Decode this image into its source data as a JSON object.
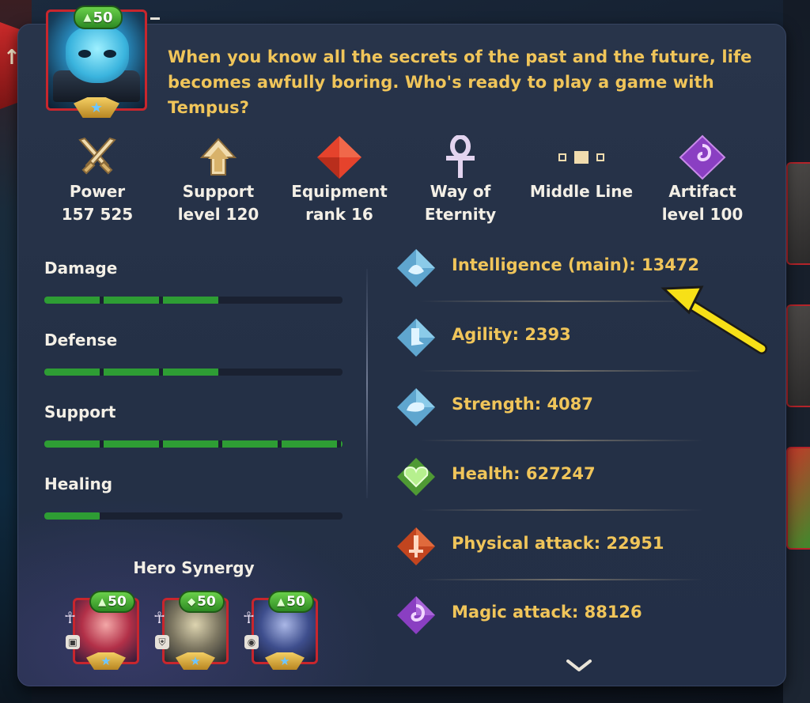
{
  "hero": {
    "level": "50",
    "quote": "When you know all the secrets of the past and the future, life becomes awfully boring. Who's ready to play a game with Tempus?"
  },
  "stats": [
    {
      "icon": "crossed-swords-icon",
      "line1": "Power",
      "line2": "157 525"
    },
    {
      "icon": "support-arrow-icon",
      "line1": "Support",
      "line2": "level 120"
    },
    {
      "icon": "red-diamond-icon",
      "line1": "Equipment",
      "line2": "rank 16"
    },
    {
      "icon": "ankh-icon",
      "line1": "Way of",
      "line2": "Eternity"
    },
    {
      "icon": "middle-line-icon",
      "line1": "Middle Line",
      "line2": ""
    },
    {
      "icon": "artifact-icon",
      "line1": "Artifact",
      "line2": "level 100"
    }
  ],
  "roles": [
    {
      "label": "Damage",
      "segments": 3,
      "max_segments": 5
    },
    {
      "label": "Defense",
      "segments": 3,
      "max_segments": 5
    },
    {
      "label": "Support",
      "segments": 5,
      "max_segments": 5
    },
    {
      "label": "Healing",
      "segments": 1,
      "max_segments": 5
    }
  ],
  "attributes": [
    {
      "icon": "intelligence-icon",
      "text": "Intelligence (main): 13472",
      "color": "#6fb4d8"
    },
    {
      "icon": "agility-icon",
      "text": "Agility: 2393",
      "color": "#6fb4d8"
    },
    {
      "icon": "strength-icon",
      "text": "Strength: 4087",
      "color": "#6fb4d8"
    },
    {
      "icon": "health-heart-icon",
      "text": "Health: 627247",
      "color": "#6cc44a"
    },
    {
      "icon": "physical-attack-icon",
      "text": "Physical attack: 22951",
      "color": "#d9562a"
    },
    {
      "icon": "magic-attack-icon",
      "text": "Magic attack: 88126",
      "color": "#9a45c8"
    }
  ],
  "synergy": {
    "title": "Hero Synergy",
    "heroes": [
      {
        "level": "50"
      },
      {
        "level": "50"
      },
      {
        "level": "50"
      }
    ]
  },
  "colors": {
    "gold_text": "#f0c55a",
    "panel": "#243046",
    "bar_fill": "#2e9d34",
    "frame_red": "#c8262d",
    "pointer_yellow": "#f7e017"
  }
}
